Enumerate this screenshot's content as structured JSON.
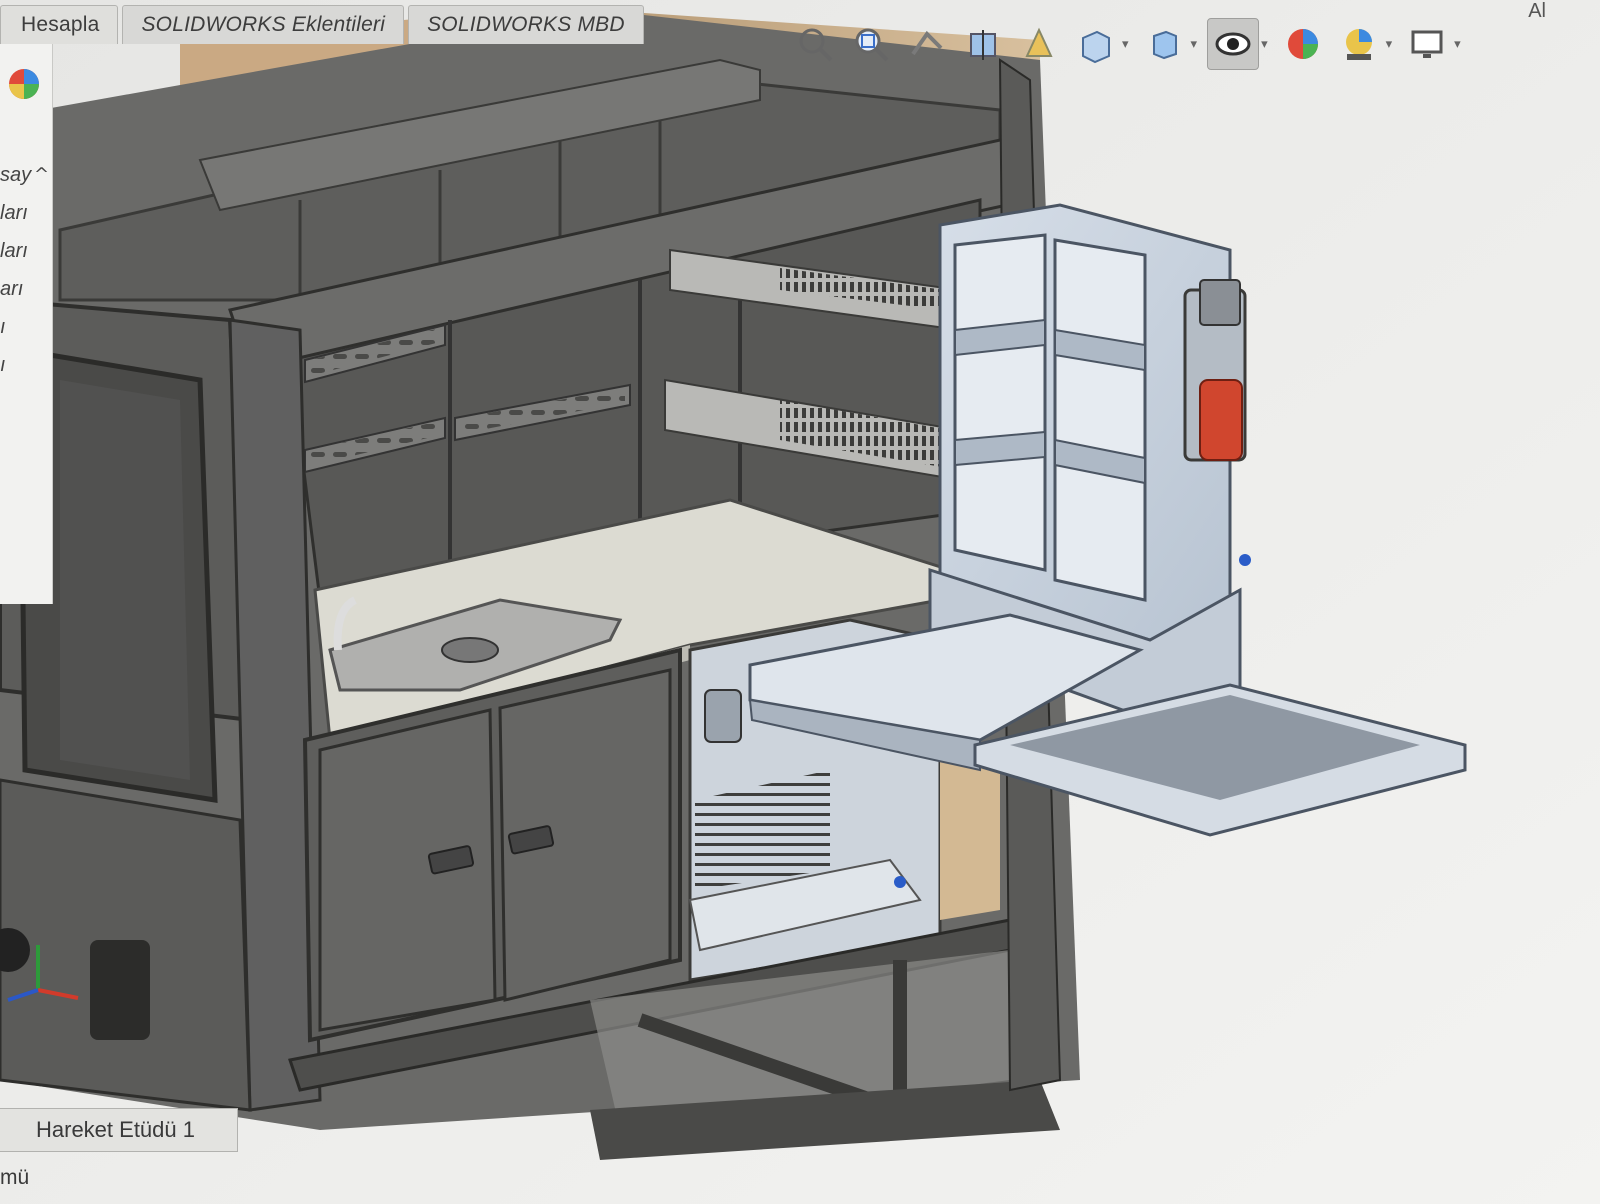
{
  "tabs": [
    {
      "label": "Hesapla"
    },
    {
      "label": "SOLIDWORKS Eklentileri"
    },
    {
      "label": "SOLIDWORKS MBD"
    }
  ],
  "corner_label": "Al",
  "view_toolbar": [
    {
      "icon": "zoom-to-fit-icon"
    },
    {
      "icon": "zoom-to-area-icon"
    },
    {
      "icon": "previous-view-icon"
    },
    {
      "icon": "section-view-icon"
    },
    {
      "icon": "dynamic-annotation-icon"
    },
    {
      "icon": "view-orientation-icon"
    },
    {
      "icon": "display-style-icon"
    },
    {
      "icon": "hide-show-items-icon"
    },
    {
      "icon": "edit-appearance-icon"
    },
    {
      "icon": "apply-scene-icon"
    },
    {
      "icon": "view-settings-icon"
    }
  ],
  "left_panel": {
    "items": [
      "say",
      "ları",
      "ları",
      "arı",
      "ı",
      "ı"
    ]
  },
  "bottom": {
    "study_tab": "Hareket Etüdü 1",
    "status_text": "mü"
  },
  "colors": {
    "frame_dark": "#5a5a58",
    "panel_gray": "#6b6b69",
    "wood": "#c9ad88",
    "counter": "#dcdbd2",
    "module_blue": "#c9d3df",
    "can_red": "#d0462e",
    "viewport_bg": "#ececea"
  }
}
